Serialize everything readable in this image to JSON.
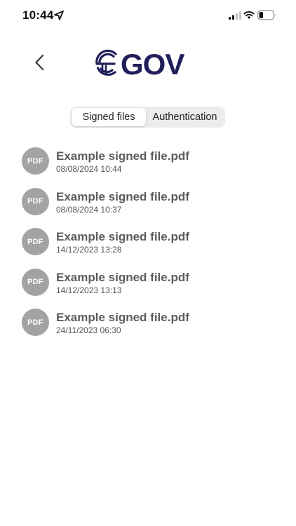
{
  "status_bar": {
    "time": "10:44"
  },
  "header": {
    "logo_text": "eGOV",
    "brand_color": "#21205a"
  },
  "tabs": [
    {
      "label": "Signed files",
      "active": true
    },
    {
      "label": "Authentication",
      "active": false
    }
  ],
  "files": [
    {
      "badge": "PDF",
      "name": "Example signed file.pdf",
      "date": "08/08/2024 10:44"
    },
    {
      "badge": "PDF",
      "name": "Example signed file.pdf",
      "date": "08/08/2024 10:37"
    },
    {
      "badge": "PDF",
      "name": "Example signed file.pdf",
      "date": "14/12/2023 13:28"
    },
    {
      "badge": "PDF",
      "name": "Example signed file.pdf",
      "date": "14/12/2023 13:13"
    },
    {
      "badge": "PDF",
      "name": "Example signed file.pdf",
      "date": "24/11/2023 06:30"
    }
  ]
}
